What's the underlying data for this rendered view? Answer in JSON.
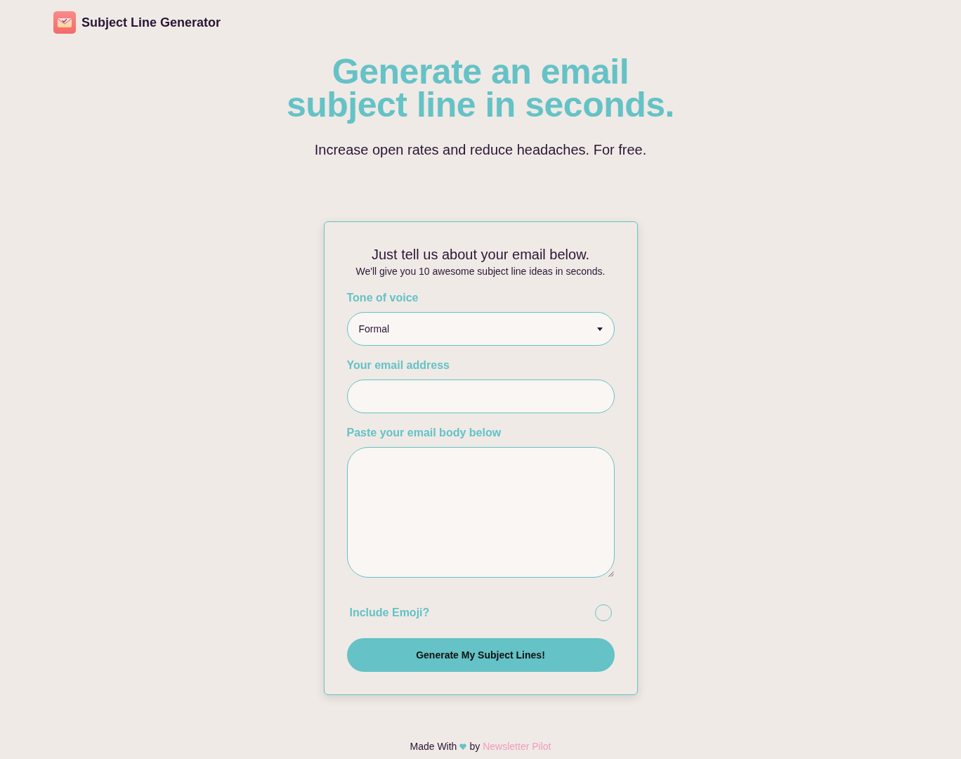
{
  "header": {
    "title": "Subject Line Generator"
  },
  "hero": {
    "heading": "Generate an email subject line in seconds.",
    "subheading": "Increase open rates and reduce headaches. For free."
  },
  "form": {
    "title": "Just tell us about your email below.",
    "subtitle": "We'll give you 10 awesome subject line ideas in seconds.",
    "fields": [
      {
        "kind": "select",
        "label": "Tone of voice",
        "value": "Formal"
      },
      {
        "kind": "input",
        "label": "Your email address"
      },
      {
        "kind": "textarea",
        "label": "Paste your email body below"
      }
    ],
    "emoji_option": {
      "label": "Include Emoji?",
      "checked": false
    },
    "submit": "Generate My Subject Lines!"
  },
  "footer": {
    "made_with": "Made With",
    "by": "by",
    "link": "Newsletter Pilot"
  }
}
